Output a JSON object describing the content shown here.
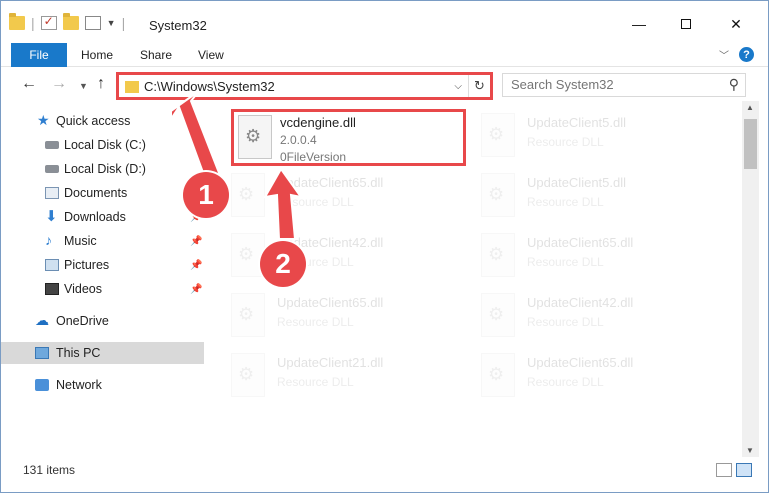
{
  "window": {
    "title": "System32"
  },
  "ribbon": {
    "tabs": {
      "file": "File",
      "home": "Home",
      "share": "Share",
      "view": "View"
    },
    "help": "?"
  },
  "address": {
    "path": "C:\\Windows\\System32"
  },
  "search": {
    "placeholder": "Search System32"
  },
  "sidebar": {
    "items": [
      {
        "label": "Quick access",
        "icon": "star-icon"
      },
      {
        "label": "Local Disk (C:)",
        "icon": "drive-icon"
      },
      {
        "label": "Local Disk (D:)",
        "icon": "drive-icon"
      },
      {
        "label": "Documents",
        "icon": "documents-icon"
      },
      {
        "label": "Downloads",
        "icon": "download-icon",
        "pinned": true
      },
      {
        "label": "Music",
        "icon": "music-icon",
        "pinned": true
      },
      {
        "label": "Pictures",
        "icon": "pictures-icon",
        "pinned": true
      },
      {
        "label": "Videos",
        "icon": "videos-icon",
        "pinned": true
      },
      {
        "label": "OneDrive",
        "icon": "cloud-icon"
      },
      {
        "label": "This PC",
        "icon": "computer-icon",
        "selected": true
      },
      {
        "label": "Network",
        "icon": "network-icon"
      }
    ]
  },
  "files": {
    "highlighted": {
      "name": "vcdengine.dll",
      "line2": "2.0.0.4",
      "line3": "0FileVersion"
    },
    "items": [
      {
        "name": "UpdateClient5.dll",
        "type": "Resource DLL"
      },
      {
        "name": "UpdateClient65.dll",
        "type": "Resource DLL"
      },
      {
        "name": "UpdateClient5.dll",
        "type": "Resource DLL"
      },
      {
        "name": "UpdateClient42.dll",
        "type": "Resource DLL"
      },
      {
        "name": "UpdateClient65.dll",
        "type": "Resource DLL"
      },
      {
        "name": "UpdateClient65.dll",
        "type": "Resource DLL"
      },
      {
        "name": "UpdateClient42.dll",
        "type": "Resource DLL"
      },
      {
        "name": "UpdateClient21.dll",
        "type": "Resource DLL"
      },
      {
        "name": "UpdateClient65.dll",
        "type": "Resource DLL"
      }
    ]
  },
  "status": {
    "count": "131 items"
  },
  "annotations": {
    "step1": "1",
    "step2": "2"
  },
  "colors": {
    "accent": "#1979ca",
    "highlight": "#e8484a"
  }
}
